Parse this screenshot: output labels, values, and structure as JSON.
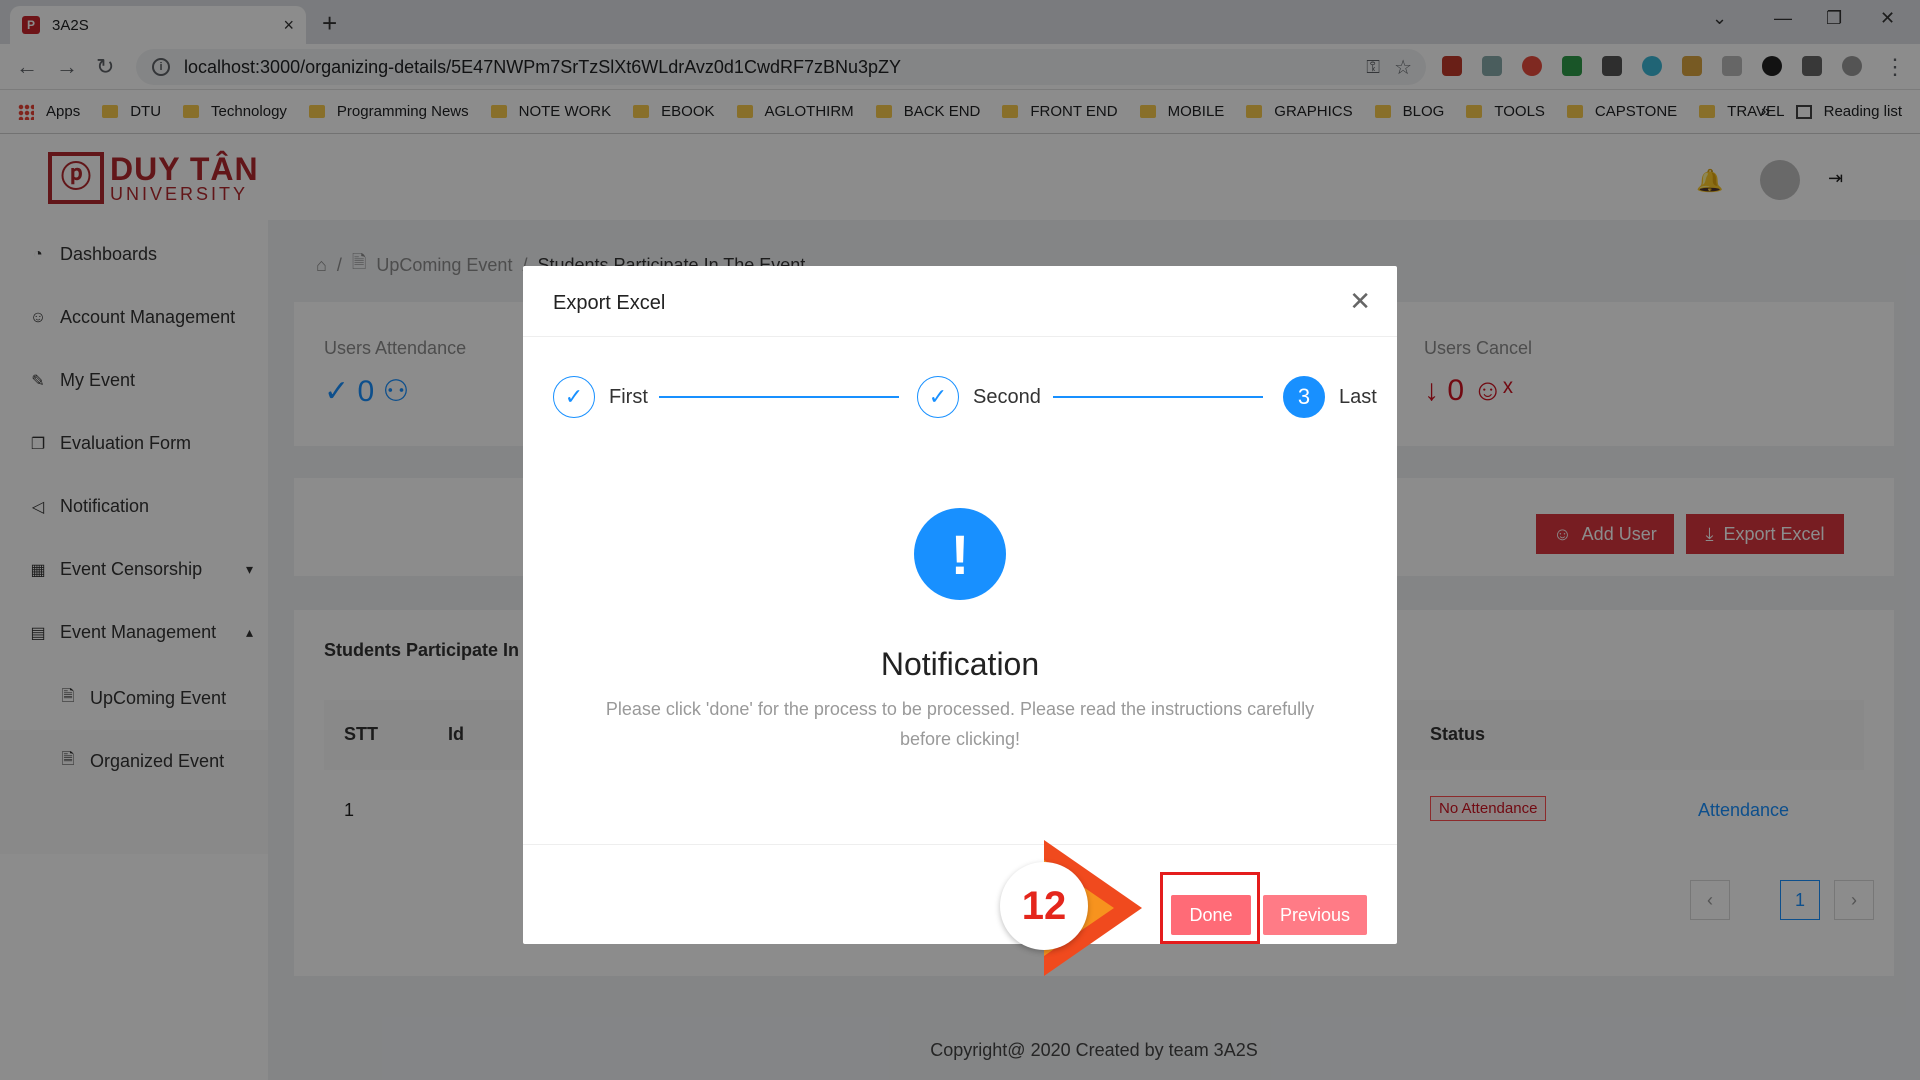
{
  "browser": {
    "tab_title": "3A2S",
    "tab_close": "×",
    "new_tab": "+",
    "url": "localhost:3000/organizing-details/5E47NWPm7SrTzSlXt6WLdrAvz0d1CwdRF7zBNu3pZY",
    "bookmarks": [
      "Apps",
      "DTU",
      "Technology",
      "Programming News",
      "NOTE WORK",
      "EBOOK",
      "AGLOTHIRM",
      "BACK END",
      "FRONT END",
      "MOBILE",
      "GRAPHICS",
      "BLOG",
      "TOOLS",
      "CAPSTONE",
      "TRAVEL"
    ],
    "more": "»",
    "reading_list": "Reading list"
  },
  "header": {
    "logo_title": "DUY TÂN",
    "logo_subtitle": "UNIVERSITY"
  },
  "sidebar": {
    "items": [
      {
        "label": "Dashboards"
      },
      {
        "label": "Account Management"
      },
      {
        "label": "My Event"
      },
      {
        "label": "Evaluation Form"
      },
      {
        "label": "Notification"
      },
      {
        "label": "Event Censorship"
      },
      {
        "label": "Event Management"
      },
      {
        "label": "UpComing Event"
      },
      {
        "label": "Organized Event"
      }
    ]
  },
  "breadcrumb": {
    "level1": "UpComing Event",
    "current": "Students Participate In The Event"
  },
  "stats": {
    "attendance_label": "Users Attendance",
    "attendance_value": "0",
    "cancel_label": "Users Cancel",
    "cancel_value": "0"
  },
  "actions": {
    "add_user": "Add User",
    "export_excel": "Export Excel"
  },
  "table": {
    "title": "Students Participate In The Event",
    "headers": {
      "stt": "STT",
      "id": "Id",
      "status": "Status"
    },
    "rows": [
      {
        "stt": "1",
        "status": "No Attendance",
        "action": "Attendance"
      }
    ]
  },
  "pagination": {
    "current": "1",
    "prev": "‹",
    "next": "›"
  },
  "footer": "Copyright@ 2020 Created by team 3A2S",
  "modal": {
    "title": "Export Excel",
    "steps": [
      {
        "label": "First"
      },
      {
        "label": "Second"
      },
      {
        "label": "Last",
        "number": "3"
      }
    ],
    "notice_title": "Notification",
    "notice_message": "Please click 'done' for the process to be processed. Please read the instructions carefully before clicking!",
    "done": "Done",
    "previous": "Previous"
  },
  "annotation": {
    "step_number": "12"
  },
  "colors": {
    "primary": "#1890ff",
    "danger": "#d9363e",
    "button_pink": "#ff7875",
    "annotation_red": "#e41c1c"
  }
}
